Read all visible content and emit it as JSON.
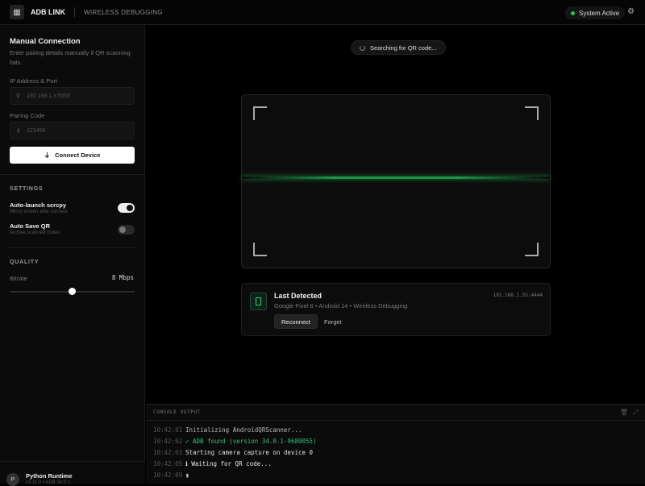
{
  "header": {
    "brand": "ADB LINK",
    "subtitle": "WIRELESS DEBUGGING",
    "status": "System Active"
  },
  "sidebar": {
    "manual": {
      "title": "Manual Connection",
      "description": "Enter pairing details manually if QR scanning fails.",
      "ip_label": "IP Address & Port",
      "ip_placeholder": "192.168.1.x:5555",
      "code_label": "Pairing Code",
      "code_placeholder": "123456",
      "connect_label": "Connect Device"
    },
    "settings": {
      "title": "SETTINGS",
      "items": [
        {
          "label": "Auto-launch scrcpy",
          "description": "Mirror screen after connect",
          "enabled": true
        },
        {
          "label": "Auto Save QR",
          "description": "Archive scanned codes",
          "enabled": false
        }
      ]
    },
    "quality": {
      "title": "QUALITY",
      "bitrate_label": "Bitrate",
      "bitrate_value": "8 Mbps",
      "bitrate_fraction": 0.5
    },
    "footer": {
      "avatar": "P",
      "title": "Python Runtime",
      "subtitle": "v3.11.0 • ADB 34.0.1"
    }
  },
  "scanner": {
    "status": "Searching for QR code..."
  },
  "last_detected": {
    "title": "Last Detected",
    "details": "Google Pixel 6 • Android 14 • Wireless Debugging",
    "address": "192.168.1.55:4444",
    "reconnect": "Reconnect",
    "forget": "Forget"
  },
  "console": {
    "title": "CONSOLE OUTPUT",
    "lines": [
      {
        "time": "10:42:01",
        "text": "Initializing AndroidQRScanner...",
        "color": "#bbbbbb"
      },
      {
        "time": "10:42:02",
        "text": "✓ ADB found (version 34.0.1-9680055)",
        "color": "#34c07a"
      },
      {
        "time": "10:42:03",
        "text": "Starting camera capture on device 0",
        "color": "#e0e0e0"
      },
      {
        "time": "10:42:05",
        "text": "ℹ Waiting for QR code...",
        "color": "#e8e8e8"
      },
      {
        "time": "10:42:09",
        "text": "▮",
        "color": "#cccccc"
      }
    ]
  }
}
